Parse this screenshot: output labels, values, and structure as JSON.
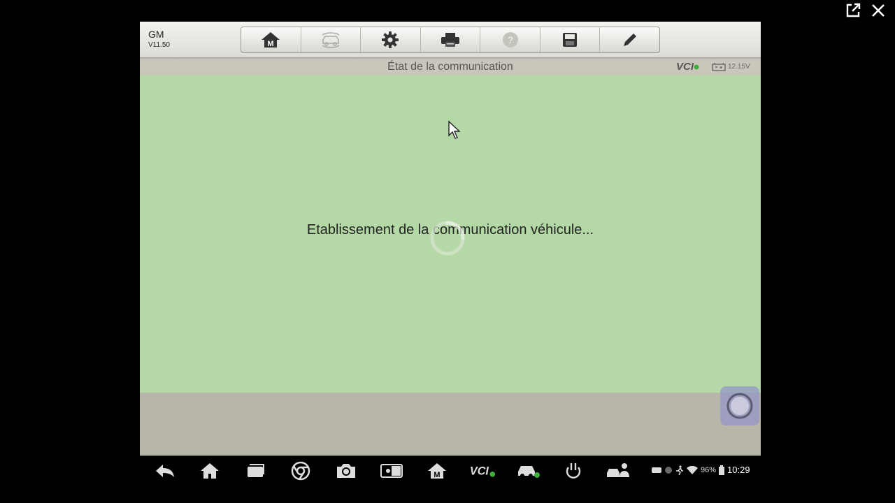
{
  "window": {
    "external_icon": "external-link-icon",
    "close_icon": "close-icon"
  },
  "header": {
    "brand": "GM",
    "version": "V11.50",
    "toolbar": [
      {
        "icon": "home-m-icon"
      },
      {
        "icon": "vehicle-swap-icon",
        "disabled": true
      },
      {
        "icon": "gear-icon"
      },
      {
        "icon": "printer-icon"
      },
      {
        "icon": "help-icon",
        "disabled": true
      },
      {
        "icon": "save-icon"
      },
      {
        "icon": "pen-icon"
      }
    ]
  },
  "titlebar": {
    "title": "État de la communication",
    "vci": "VCI",
    "battery_voltage": "12.15V"
  },
  "main": {
    "status_message": "Etablissement de la communication véhicule..."
  },
  "navbar": {
    "battery_percent": "96%",
    "time": "10:29"
  },
  "colors": {
    "main_bg": "#b5d9a6",
    "footer_bg": "#b8b6a8",
    "header_bg": "#e8e7e3"
  }
}
